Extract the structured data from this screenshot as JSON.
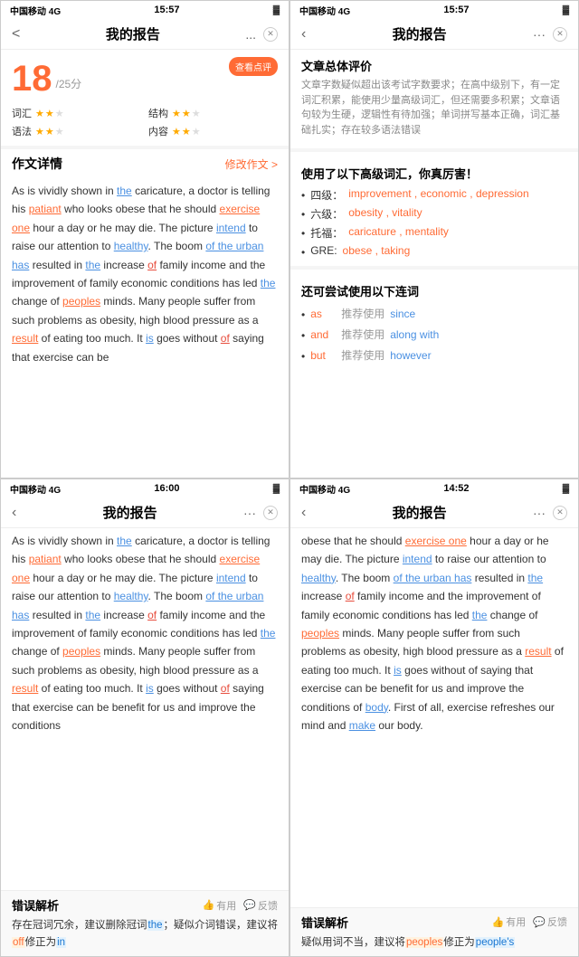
{
  "panels": [
    {
      "id": "top-left",
      "status": {
        "left": "中国移动 4G",
        "center": "15:57",
        "right": "🔋"
      },
      "nav": {
        "title": "我的报告",
        "more": "...",
        "back": "<"
      },
      "score": {
        "check_btn": "查看点评",
        "number": "18",
        "total": "/25分",
        "items": [
          {
            "label": "词汇",
            "stars": 2,
            "max": 3
          },
          {
            "label": "结构",
            "stars": 2,
            "max": 3
          },
          {
            "label": "语法",
            "stars": 2,
            "max": 3
          },
          {
            "label": "内容",
            "stars": 2,
            "max": 3
          }
        ]
      },
      "essay": {
        "title": "作文详情",
        "edit": "修改作文 >",
        "text": "As is vividly shown in the caricature, a doctor is telling his patiant who looks obese that he should exercise one hour a day or he may die. The picture intend to raise our attention to healthy. The boom of the urban has resulted in the increase of family income and the improvement of family economic conditions has led the change of peoples minds. Many people suffer from such problems as obesity, high blood pressure as a result of eating too much. It is goes without of saying that exercise can be"
      }
    },
    {
      "id": "top-right",
      "status": {
        "left": "中国移动 4G",
        "center": "15:57",
        "right": "🔋"
      },
      "nav": {
        "title": "我的报告",
        "more": "...",
        "back": "<"
      },
      "overall_title": "文章总体评价",
      "overall_text": "文章字数疑似超出该考试字数要求；在高中级别下，有一定词汇积累，能使用少量高级词汇，但还需要多积累；文章语句较为生硬，逻辑性有待加强；单词拼写基本正确，词汇基础扎实；存在较多语法错误",
      "vocab_title": "使用了以下高级词汇，你真厉害！",
      "vocab_items": [
        {
          "level": "四级：",
          "words": "improvement , economic , depression"
        },
        {
          "level": "六级：",
          "words": "obesity , vitality"
        },
        {
          "level": "托福：",
          "words": "caricature , mentality"
        },
        {
          "level": "GRE:",
          "words": "obese , taking"
        }
      ],
      "conjunct_title": "还可尝试使用以下连词",
      "conjunct_items": [
        {
          "word": "as",
          "suggest": "推荐使用",
          "alt": "since"
        },
        {
          "word": "and",
          "suggest": "推荐使用",
          "alt": "along with"
        },
        {
          "word": "but",
          "suggest": "推荐使用",
          "alt": "however"
        }
      ]
    },
    {
      "id": "bottom-left",
      "status": {
        "left": "中国移动 4G",
        "center": "16:00",
        "right": "🔋"
      },
      "nav": {
        "title": "我的报告",
        "more": "...",
        "back": "<"
      },
      "essay_text": "As is vividly shown in the caricature, a doctor is telling his patiant who looks obese that he should exercise one hour a day or he may die. The picture intend to raise our attention to healthy. The boom of the urban has resulted in the increase of family income and the improvement of family economic conditions has led the change of peoples minds. Many people suffer from such problems as obesity, high blood pressure as a result of eating too much. It is goes without of saying that exercise can be benefit for us and improve the conditions",
      "error": {
        "title": "错误解析",
        "useful": "有用",
        "feedback": "反馈",
        "desc": "存在冠词冗余，建议删除冠词the；疑似介词错误，建议将off修正为in"
      }
    },
    {
      "id": "bottom-right",
      "status": {
        "left": "中国移动 4G",
        "center": "14:52",
        "right": "🔋"
      },
      "nav": {
        "title": "我的报告",
        "more": "...",
        "back": "<"
      },
      "essay_text": "obese that he should exercise one hour a day or he may die. The picture intend to raise our attention to healthy. The boom of the urban has resulted in the increase of family income and the improvement of family economic conditions has led the change of peoples minds. Many people suffer from such problems as obesity, high blood pressure as a result of eating too much. It is goes without of saying that exercise can be benefit for us and improve the conditions of body. First of all, exercise refreshes our mind and make our body.",
      "error": {
        "title": "错误解析",
        "useful": "有用",
        "feedback": "反馈",
        "desc": "疑似用词不当，建议将peoples修正为people's"
      }
    }
  ]
}
